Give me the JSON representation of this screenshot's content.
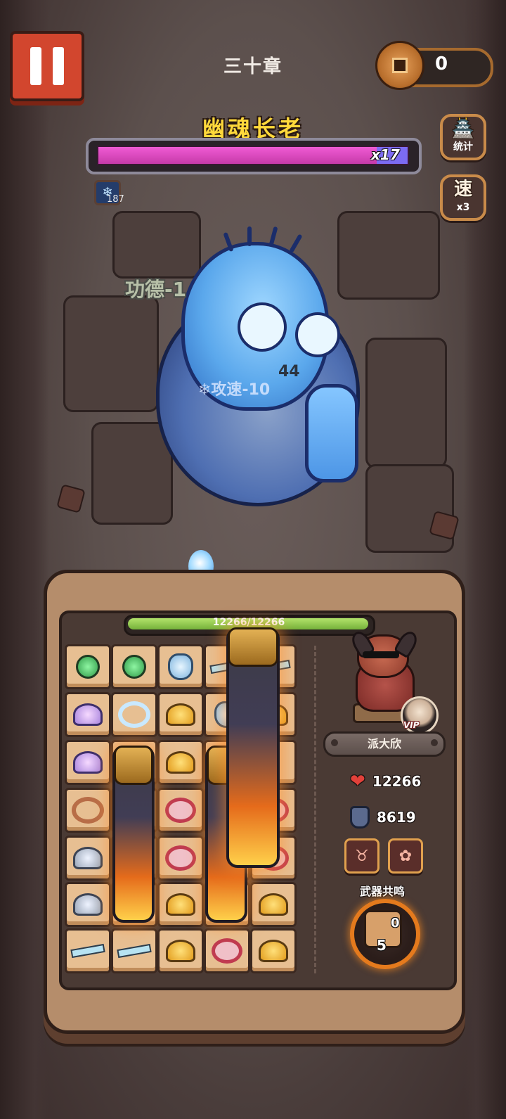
{
  "header": {
    "chapter": "三十章",
    "coin_value": "0"
  },
  "boss": {
    "name": "幽魂长老",
    "hp_multiplier": "x17",
    "frost_stack": "187",
    "float_merit": "功德-1",
    "float_speed": "❄攻速-10",
    "float_number": "44"
  },
  "side_buttons": {
    "stats_label": "统计",
    "stats_glyph": "🏯",
    "speed_glyph": "速",
    "speed_label": "x3"
  },
  "player": {
    "hp_text": "12266/12266",
    "name": "派大欣",
    "vip_label": "VIP",
    "hp": "12266",
    "defense": "8619"
  },
  "resonance": {
    "title": "武器共鸣",
    "level": "0",
    "count": "5"
  },
  "icons": {
    "heart": "heart-icon",
    "shield": "shield-icon",
    "frost": "snowflake-icon",
    "coin": "coin-icon"
  },
  "colors": {
    "boss_hp": "#d84bbd",
    "player_hp": "#8fc84c",
    "accent_gold": "#ffd93b",
    "pause_red": "#d2462e"
  }
}
